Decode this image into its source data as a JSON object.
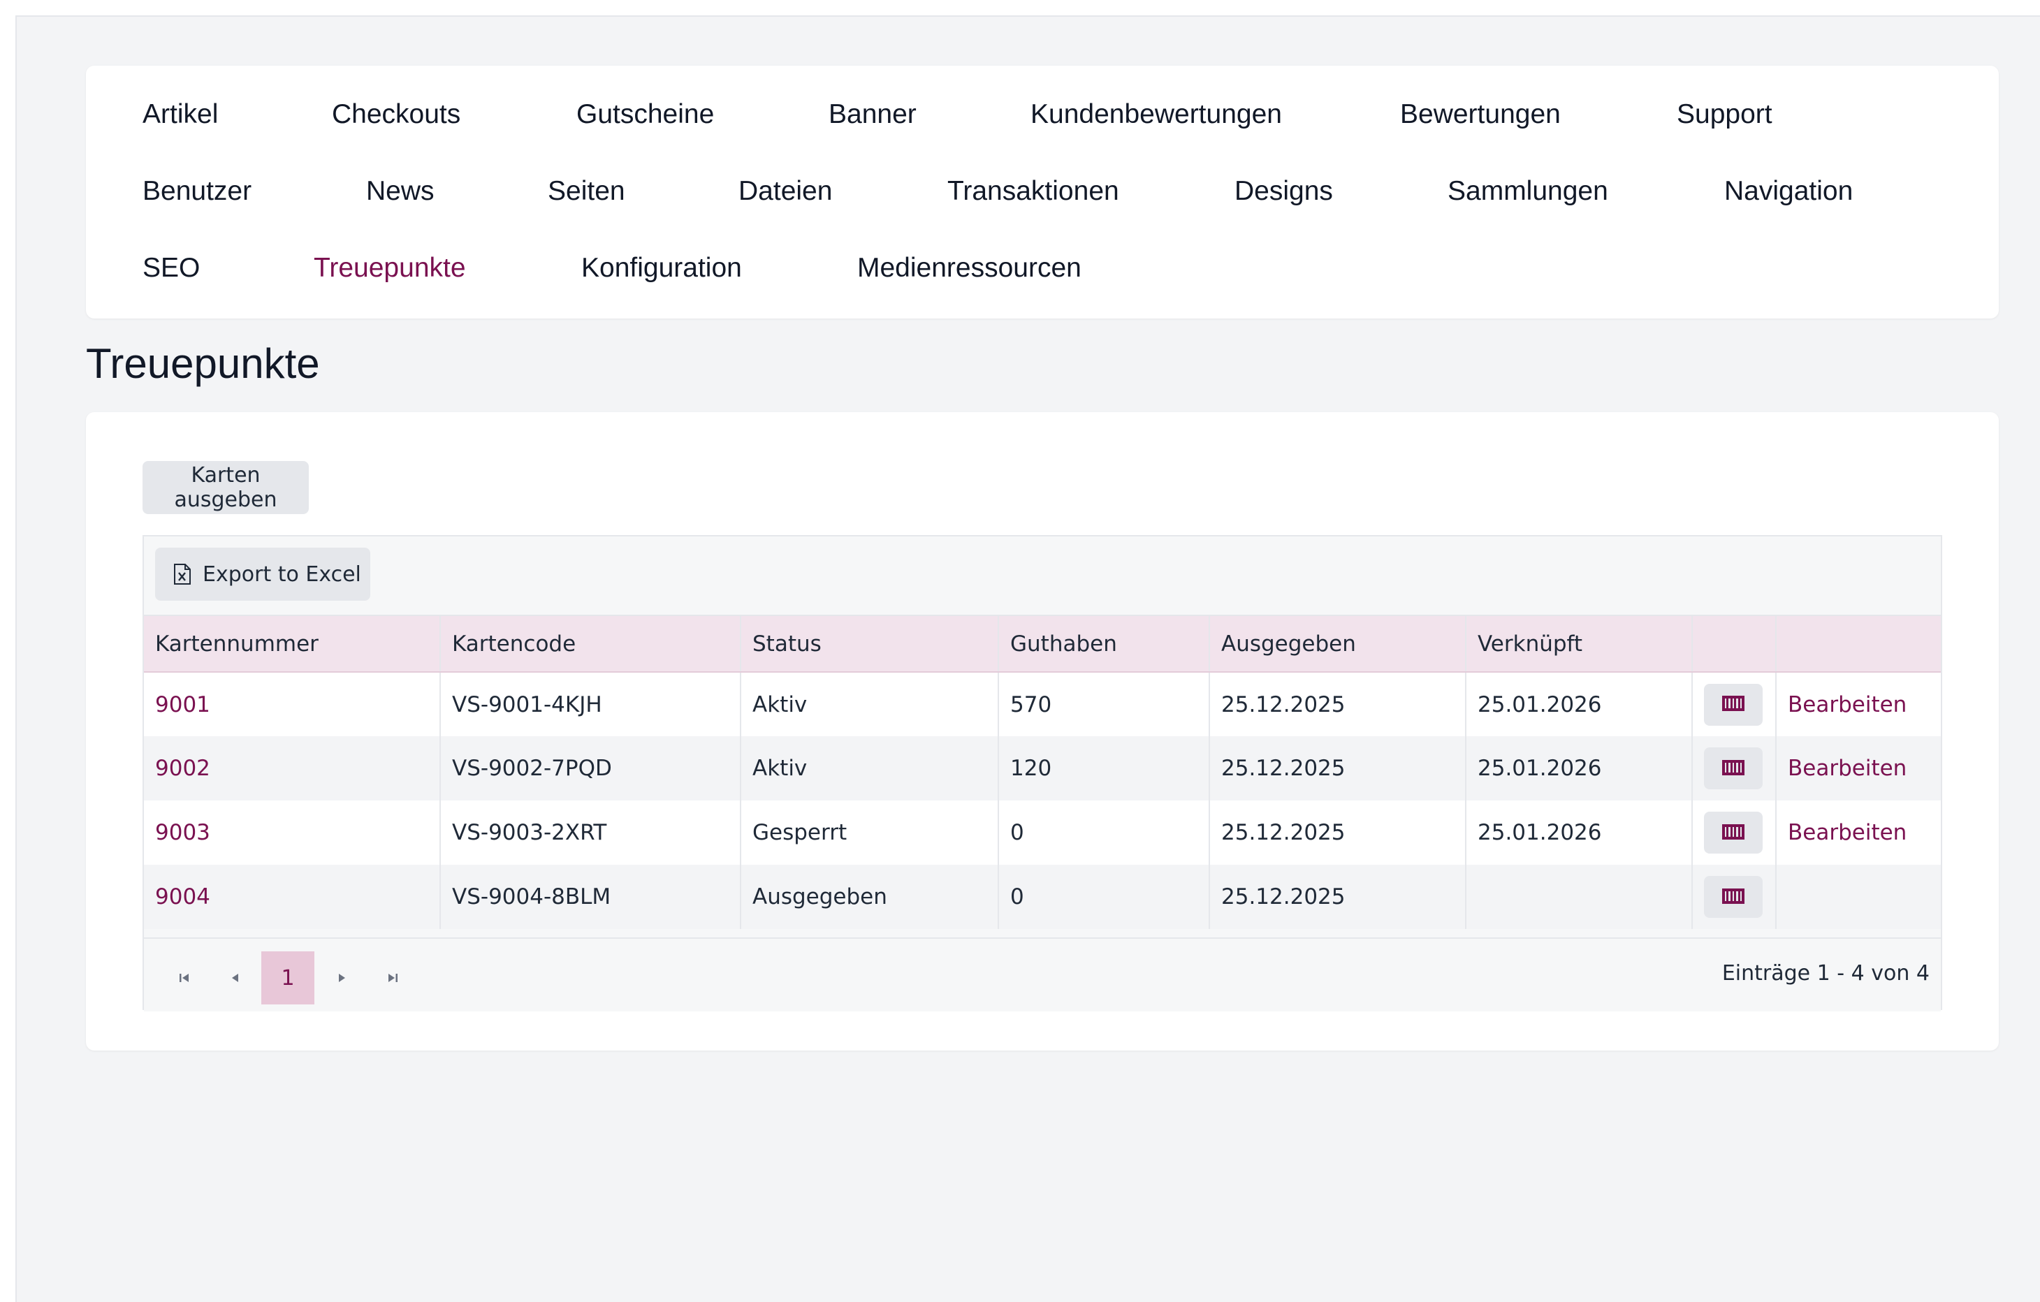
{
  "nav": {
    "items": [
      {
        "label": "Artikel"
      },
      {
        "label": "Checkouts"
      },
      {
        "label": "Gutscheine"
      },
      {
        "label": "Banner"
      },
      {
        "label": "Kundenbewertungen"
      },
      {
        "label": "Bewertungen"
      },
      {
        "label": "Support"
      },
      {
        "label": "Benutzer"
      },
      {
        "label": "News"
      },
      {
        "label": "Seiten"
      },
      {
        "label": "Dateien"
      },
      {
        "label": "Transaktionen"
      },
      {
        "label": "Designs"
      },
      {
        "label": "Sammlungen"
      },
      {
        "label": "Navigation"
      },
      {
        "label": "SEO"
      },
      {
        "label": "Treuepunkte"
      },
      {
        "label": "Konfiguration"
      },
      {
        "label": "Medienressourcen"
      }
    ],
    "active_index": 16,
    "active_color": "#7a1150"
  },
  "page": {
    "title": "Treuepunkte"
  },
  "actions": {
    "issue_cards_label": "Karten ausgeben",
    "export_label": "Export to Excel",
    "export_icon": "excel-file-icon"
  },
  "table": {
    "columns": [
      "Kartennummer",
      "Kartencode",
      "Status",
      "Guthaben",
      "Ausgegeben",
      "Verknüpft",
      "",
      ""
    ],
    "rows": [
      {
        "number": "9001",
        "code": "VS-9001-4KJH",
        "status": "Aktiv",
        "balance": "570",
        "issued": "25.12.2025",
        "linked": "25.01.2026",
        "edit": "Bearbeiten"
      },
      {
        "number": "9002",
        "code": "VS-9002-7PQD",
        "status": "Aktiv",
        "balance": "120",
        "issued": "25.12.2025",
        "linked": "25.01.2026",
        "edit": "Bearbeiten"
      },
      {
        "number": "9003",
        "code": "VS-9003-2XRT",
        "status": "Gesperrt",
        "balance": "0",
        "issued": "25.12.2025",
        "linked": "25.01.2026",
        "edit": "Bearbeiten"
      },
      {
        "number": "9004",
        "code": "VS-9004-8BLM",
        "status": "Ausgegeben",
        "balance": "0",
        "issued": "25.12.2025",
        "linked": "",
        "edit": ""
      }
    ],
    "row_icon": "barcode-icon"
  },
  "pager": {
    "current_page": "1",
    "info": "Einträge 1 - 4 von 4"
  },
  "colors": {
    "accent": "#7a1150",
    "header_bg": "#f2e3ec",
    "page_bg": "#f3f4f6"
  }
}
